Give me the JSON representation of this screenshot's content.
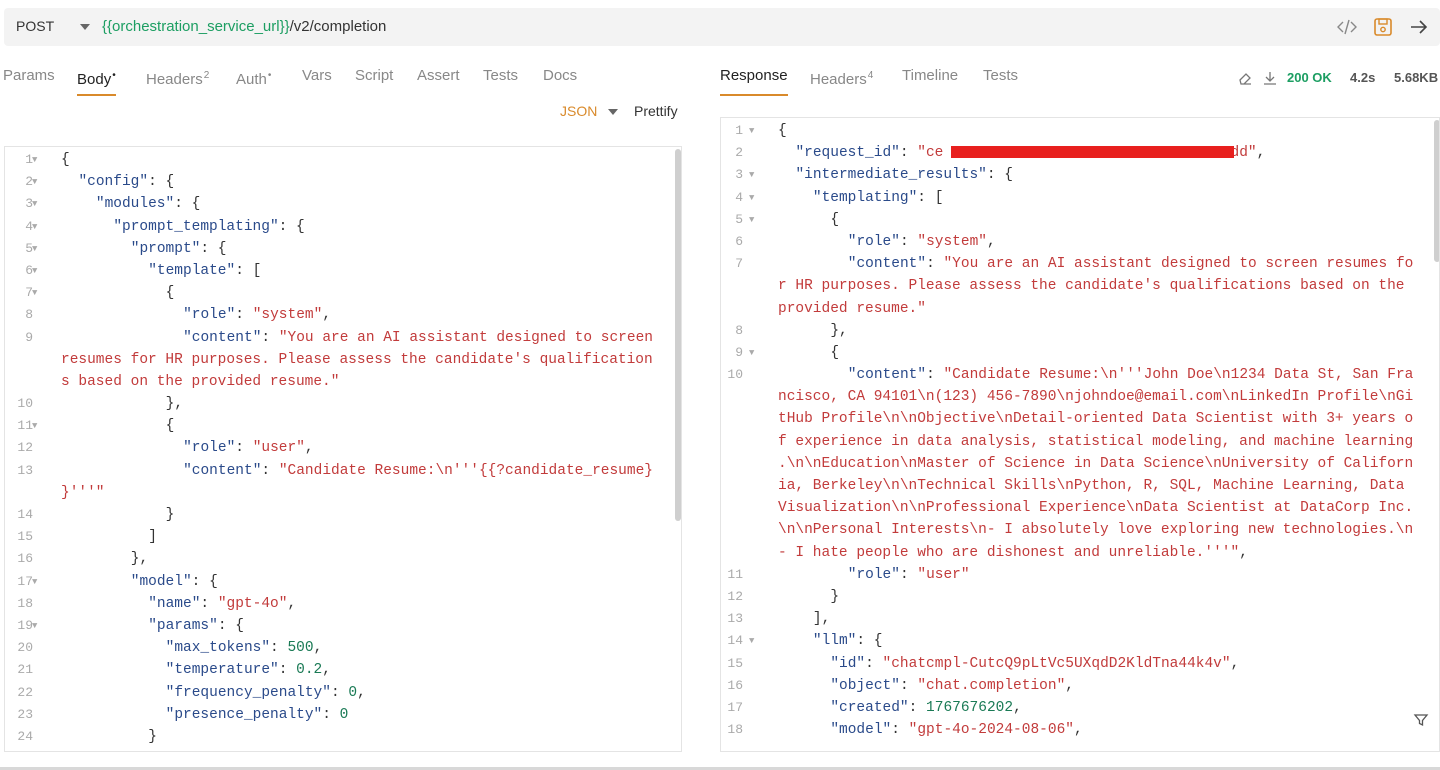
{
  "request": {
    "method": "POST",
    "url_var": "{{orchestration_service_url}}",
    "url_path": "/v2/completion",
    "icons": [
      "code-icon",
      "save-icon",
      "send-arrow-icon"
    ]
  },
  "request_tabs": [
    {
      "label": "Params",
      "sup": ""
    },
    {
      "label": "Body",
      "sup": "•"
    },
    {
      "label": "Headers",
      "sup": "2"
    },
    {
      "label": "Auth",
      "sup": "•"
    },
    {
      "label": "Vars",
      "sup": ""
    },
    {
      "label": "Script",
      "sup": ""
    },
    {
      "label": "Assert",
      "sup": ""
    },
    {
      "label": "Tests",
      "sup": ""
    },
    {
      "label": "Docs",
      "sup": ""
    }
  ],
  "body_mode": {
    "format": "JSON",
    "prettify": "Prettify"
  },
  "response_tabs": [
    {
      "label": "Response",
      "sup": ""
    },
    {
      "label": "Headers",
      "sup": "4"
    },
    {
      "label": "Timeline",
      "sup": ""
    },
    {
      "label": "Tests",
      "sup": ""
    }
  ],
  "status": {
    "code": "200 OK",
    "time": "4.2s",
    "size": "5.68KB",
    "color_ok": "#1c9e62"
  },
  "request_body": [
    {
      "n": "1",
      "fold": true,
      "ind": 0,
      "t": [
        [
          "p",
          "{"
        ]
      ]
    },
    {
      "n": "2",
      "fold": true,
      "ind": 1,
      "t": [
        [
          "k",
          "\"config\""
        ],
        [
          "p",
          ": {"
        ]
      ]
    },
    {
      "n": "3",
      "fold": true,
      "ind": 2,
      "t": [
        [
          "k",
          "\"modules\""
        ],
        [
          "p",
          ": {"
        ]
      ]
    },
    {
      "n": "4",
      "fold": true,
      "ind": 3,
      "t": [
        [
          "k",
          "\"prompt_templating\""
        ],
        [
          "p",
          ": {"
        ]
      ]
    },
    {
      "n": "5",
      "fold": true,
      "ind": 4,
      "t": [
        [
          "k",
          "\"prompt\""
        ],
        [
          "p",
          ": {"
        ]
      ]
    },
    {
      "n": "6",
      "fold": true,
      "ind": 5,
      "t": [
        [
          "k",
          "\"template\""
        ],
        [
          "p",
          ": ["
        ]
      ]
    },
    {
      "n": "7",
      "fold": true,
      "ind": 6,
      "t": [
        [
          "p",
          "{"
        ]
      ]
    },
    {
      "n": "8",
      "fold": false,
      "ind": 7,
      "t": [
        [
          "k",
          "\"role\""
        ],
        [
          "p",
          ": "
        ],
        [
          "s",
          "\"system\""
        ],
        [
          "p",
          ","
        ]
      ]
    },
    {
      "n": "9",
      "fold": false,
      "ind": 7,
      "t": [
        [
          "k",
          "\"content\""
        ],
        [
          "p",
          ": "
        ],
        [
          "s",
          "\"You are an AI assistant designed to screen"
        ]
      ]
    },
    {
      "n": "",
      "fold": false,
      "ind": 0,
      "t": [
        [
          "s",
          "resumes for HR purposes. Please assess the candidate's qualification"
        ]
      ]
    },
    {
      "n": "",
      "fold": false,
      "ind": 0,
      "t": [
        [
          "s",
          "s based on the provided resume.\""
        ]
      ]
    },
    {
      "n": "10",
      "fold": false,
      "ind": 6,
      "t": [
        [
          "p",
          "},"
        ]
      ]
    },
    {
      "n": "11",
      "fold": true,
      "ind": 6,
      "t": [
        [
          "p",
          "{"
        ]
      ]
    },
    {
      "n": "12",
      "fold": false,
      "ind": 7,
      "t": [
        [
          "k",
          "\"role\""
        ],
        [
          "p",
          ": "
        ],
        [
          "s",
          "\"user\""
        ],
        [
          "p",
          ","
        ]
      ]
    },
    {
      "n": "13",
      "fold": false,
      "ind": 7,
      "t": [
        [
          "k",
          "\"content\""
        ],
        [
          "p",
          ": "
        ],
        [
          "s",
          "\"Candidate Resume:\\n'''{{?candidate_resume}"
        ]
      ]
    },
    {
      "n": "",
      "fold": false,
      "ind": 0,
      "t": [
        [
          "s",
          "}'''\""
        ]
      ]
    },
    {
      "n": "14",
      "fold": false,
      "ind": 6,
      "t": [
        [
          "p",
          "}"
        ]
      ]
    },
    {
      "n": "15",
      "fold": false,
      "ind": 5,
      "t": [
        [
          "p",
          "]"
        ]
      ]
    },
    {
      "n": "16",
      "fold": false,
      "ind": 4,
      "t": [
        [
          "p",
          "},"
        ]
      ]
    },
    {
      "n": "17",
      "fold": true,
      "ind": 4,
      "t": [
        [
          "k",
          "\"model\""
        ],
        [
          "p",
          ": {"
        ]
      ]
    },
    {
      "n": "18",
      "fold": false,
      "ind": 5,
      "t": [
        [
          "k",
          "\"name\""
        ],
        [
          "p",
          ": "
        ],
        [
          "s",
          "\"gpt-4o\""
        ],
        [
          "p",
          ","
        ]
      ]
    },
    {
      "n": "19",
      "fold": true,
      "ind": 5,
      "t": [
        [
          "k",
          "\"params\""
        ],
        [
          "p",
          ": {"
        ]
      ]
    },
    {
      "n": "20",
      "fold": false,
      "ind": 6,
      "t": [
        [
          "k",
          "\"max_tokens\""
        ],
        [
          "p",
          ": "
        ],
        [
          "n",
          "500"
        ],
        [
          "p",
          ","
        ]
      ]
    },
    {
      "n": "21",
      "fold": false,
      "ind": 6,
      "t": [
        [
          "k",
          "\"temperature\""
        ],
        [
          "p",
          ": "
        ],
        [
          "n",
          "0.2"
        ],
        [
          "p",
          ","
        ]
      ]
    },
    {
      "n": "22",
      "fold": false,
      "ind": 6,
      "t": [
        [
          "k",
          "\"frequency_penalty\""
        ],
        [
          "p",
          ": "
        ],
        [
          "n",
          "0"
        ],
        [
          "p",
          ","
        ]
      ]
    },
    {
      "n": "23",
      "fold": false,
      "ind": 6,
      "t": [
        [
          "k",
          "\"presence_penalty\""
        ],
        [
          "p",
          ": "
        ],
        [
          "n",
          "0"
        ]
      ]
    },
    {
      "n": "24",
      "fold": false,
      "ind": 5,
      "t": [
        [
          "p",
          "}"
        ]
      ]
    }
  ],
  "response_body": [
    {
      "n": "1",
      "fold": true,
      "ind": 0,
      "t": [
        [
          "p",
          "{"
        ]
      ]
    },
    {
      "n": "2",
      "fold": false,
      "ind": 1,
      "t": [
        [
          "k",
          "\"request_id\""
        ],
        [
          "p",
          ": "
        ],
        [
          "s",
          "\"ce"
        ],
        [
          "s",
          "                                 "
        ],
        [
          "s",
          "dd\""
        ],
        [
          "p",
          ","
        ]
      ],
      "redact": true
    },
    {
      "n": "3",
      "fold": true,
      "ind": 1,
      "t": [
        [
          "k",
          "\"intermediate_results\""
        ],
        [
          "p",
          ": {"
        ]
      ]
    },
    {
      "n": "4",
      "fold": true,
      "ind": 2,
      "t": [
        [
          "k",
          "\"templating\""
        ],
        [
          "p",
          ": ["
        ]
      ]
    },
    {
      "n": "5",
      "fold": true,
      "ind": 3,
      "t": [
        [
          "p",
          "{"
        ]
      ]
    },
    {
      "n": "6",
      "fold": false,
      "ind": 4,
      "t": [
        [
          "k",
          "\"role\""
        ],
        [
          "p",
          ": "
        ],
        [
          "s",
          "\"system\""
        ],
        [
          "p",
          ","
        ]
      ]
    },
    {
      "n": "7",
      "fold": false,
      "ind": 4,
      "t": [
        [
          "k",
          "\"content\""
        ],
        [
          "p",
          ": "
        ],
        [
          "s",
          "\"You are an AI assistant designed to screen resumes fo"
        ]
      ]
    },
    {
      "n": "",
      "fold": false,
      "ind": 0,
      "t": [
        [
          "s",
          "r HR purposes. Please assess the candidate's qualifications based on the"
        ]
      ]
    },
    {
      "n": "",
      "fold": false,
      "ind": 0,
      "t": [
        [
          "s",
          "provided resume.\""
        ]
      ]
    },
    {
      "n": "8",
      "fold": false,
      "ind": 3,
      "t": [
        [
          "p",
          "},"
        ]
      ]
    },
    {
      "n": "9",
      "fold": true,
      "ind": 3,
      "t": [
        [
          "p",
          "{"
        ]
      ]
    },
    {
      "n": "10",
      "fold": false,
      "ind": 4,
      "t": [
        [
          "k",
          "\"content\""
        ],
        [
          "p",
          ": "
        ],
        [
          "s",
          "\"Candidate Resume:\\n'''John Doe\\n1234 Data St, San Fra"
        ]
      ]
    },
    {
      "n": "",
      "fold": false,
      "ind": 0,
      "t": [
        [
          "s",
          "ncisco, CA 94101\\n(123) 456-7890\\njohndoe@email.com\\nLinkedIn Profile\\nGi"
        ]
      ]
    },
    {
      "n": "",
      "fold": false,
      "ind": 0,
      "t": [
        [
          "s",
          "tHub Profile\\n\\nObjective\\nDetail-oriented Data Scientist with 3+ years o"
        ]
      ]
    },
    {
      "n": "",
      "fold": false,
      "ind": 0,
      "t": [
        [
          "s",
          "f experience in data analysis, statistical modeling, and machine learning"
        ]
      ]
    },
    {
      "n": "",
      "fold": false,
      "ind": 0,
      "t": [
        [
          "s",
          ".\\n\\nEducation\\nMaster of Science in Data Science\\nUniversity of Californ"
        ]
      ]
    },
    {
      "n": "",
      "fold": false,
      "ind": 0,
      "t": [
        [
          "s",
          "ia, Berkeley\\n\\nTechnical Skills\\nPython, R, SQL, Machine Learning, Data"
        ]
      ]
    },
    {
      "n": "",
      "fold": false,
      "ind": 0,
      "t": [
        [
          "s",
          "Visualization\\n\\nProfessional Experience\\nData Scientist at DataCorp Inc."
        ]
      ]
    },
    {
      "n": "",
      "fold": false,
      "ind": 0,
      "t": [
        [
          "s",
          "\\n\\nPersonal Interests\\n- I absolutely love exploring new technologies.\\n"
        ]
      ]
    },
    {
      "n": "",
      "fold": false,
      "ind": 0,
      "t": [
        [
          "s",
          "- I hate people who are dishonest and unreliable.'''\""
        ],
        [
          "p",
          ","
        ]
      ]
    },
    {
      "n": "11",
      "fold": false,
      "ind": 4,
      "t": [
        [
          "k",
          "\"role\""
        ],
        [
          "p",
          ": "
        ],
        [
          "s",
          "\"user\""
        ]
      ]
    },
    {
      "n": "12",
      "fold": false,
      "ind": 3,
      "t": [
        [
          "p",
          "}"
        ]
      ]
    },
    {
      "n": "13",
      "fold": false,
      "ind": 2,
      "t": [
        [
          "p",
          "],"
        ]
      ]
    },
    {
      "n": "14",
      "fold": true,
      "ind": 2,
      "t": [
        [
          "k",
          "\"llm\""
        ],
        [
          "p",
          ": {"
        ]
      ]
    },
    {
      "n": "15",
      "fold": false,
      "ind": 3,
      "t": [
        [
          "k",
          "\"id\""
        ],
        [
          "p",
          ": "
        ],
        [
          "s",
          "\"chatcmpl-CutcQ9pLtVc5UXqdD2KldTna44k4v\""
        ],
        [
          "p",
          ","
        ]
      ]
    },
    {
      "n": "16",
      "fold": false,
      "ind": 3,
      "t": [
        [
          "k",
          "\"object\""
        ],
        [
          "p",
          ": "
        ],
        [
          "s",
          "\"chat.completion\""
        ],
        [
          "p",
          ","
        ]
      ]
    },
    {
      "n": "17",
      "fold": false,
      "ind": 3,
      "t": [
        [
          "k",
          "\"created\""
        ],
        [
          "p",
          ": "
        ],
        [
          "n",
          "1767676202"
        ],
        [
          "p",
          ","
        ]
      ]
    },
    {
      "n": "18",
      "fold": false,
      "ind": 3,
      "t": [
        [
          "k",
          "\"model\""
        ],
        [
          "p",
          ": "
        ],
        [
          "s",
          "\"gpt-4o-2024-08-06\""
        ],
        [
          "p",
          ","
        ]
      ]
    }
  ]
}
